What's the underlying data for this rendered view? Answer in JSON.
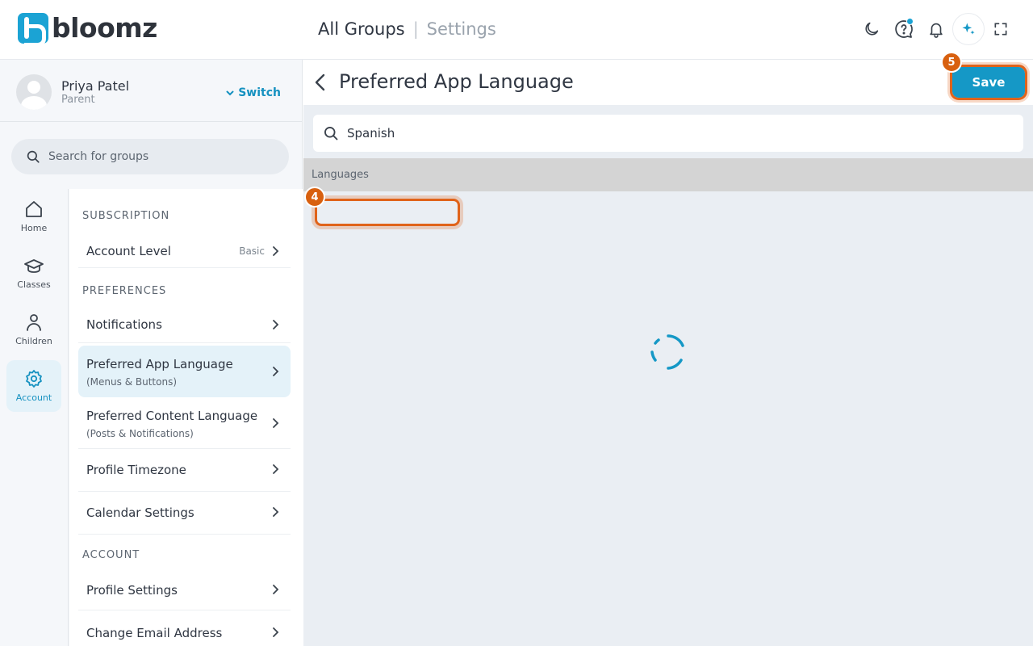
{
  "brand": {
    "name": "bloomz"
  },
  "header": {
    "breadcrumb_main": "All Groups",
    "breadcrumb_sep": "|",
    "breadcrumb_sub": "Settings"
  },
  "top_icons": [
    "moon-icon",
    "help-chat-icon",
    "bell-icon",
    "sparkle-icon",
    "fullscreen-icon"
  ],
  "profile": {
    "name": "Priya Patel",
    "role": "Parent",
    "switch_label": "Switch"
  },
  "group_search": {
    "placeholder": "Search for groups"
  },
  "nav": [
    {
      "label": "Home",
      "icon": "home-icon"
    },
    {
      "label": "Classes",
      "icon": "graduation-cap-icon"
    },
    {
      "label": "Children",
      "icon": "person-icon"
    },
    {
      "label": "Account",
      "icon": "gear-icon",
      "active": true
    }
  ],
  "settings": {
    "subscription_title": "SUBSCRIPTION",
    "account_level": {
      "label": "Account Level",
      "badge": "Basic"
    },
    "preferences_title": "PREFERENCES",
    "notifications": {
      "label": "Notifications"
    },
    "app_language": {
      "label": "Preferred App Language",
      "sub": "(Menus & Buttons)"
    },
    "content_language": {
      "label": "Preferred Content Language",
      "sub": "(Posts & Notifications)"
    },
    "timezone": {
      "label": "Profile Timezone"
    },
    "calendar": {
      "label": "Calendar Settings"
    },
    "account_title": "ACCOUNT",
    "profile_settings": {
      "label": "Profile Settings"
    },
    "change_email": {
      "label": "Change Email Address"
    }
  },
  "main": {
    "title": "Preferred App Language",
    "save_label": "Save",
    "search_value": "Spanish",
    "section_label": "Languages",
    "markers": {
      "highlight": "4",
      "save": "5"
    }
  },
  "colors": {
    "accent": "#1598c6",
    "highlight": "#e0631a",
    "active_bg": "#e4f2f9"
  }
}
